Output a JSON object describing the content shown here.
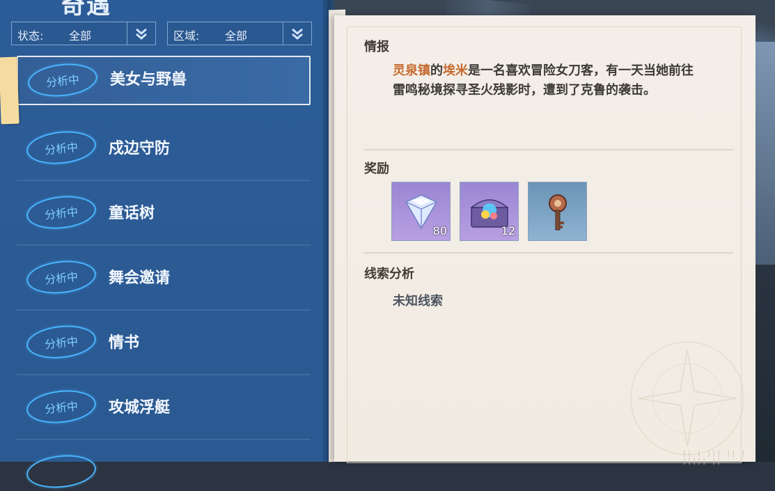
{
  "header": {
    "title": "奇遇"
  },
  "filters": {
    "status": {
      "label": "状态:",
      "value": "全部"
    },
    "region": {
      "label": "区域:",
      "value": "全部"
    }
  },
  "quests": [
    {
      "status": "分析中",
      "name": "美女与野兽",
      "selected": true
    },
    {
      "status": "分析中",
      "name": "戍边守防"
    },
    {
      "status": "分析中",
      "name": "童话树"
    },
    {
      "status": "分析中",
      "name": "舞会邀请"
    },
    {
      "status": "分析中",
      "name": "情书"
    },
    {
      "status": "分析中",
      "name": "攻城浮艇"
    },
    {
      "status": "分析中",
      "name": ""
    }
  ],
  "detail": {
    "intel_title": "情报",
    "intel": {
      "place": "灵泉镇",
      "of": "的",
      "person": "埃米",
      "rest_line1": "是一名喜欢冒险女刀客，有一天当她前往",
      "line2": "雷鸣秘境探寻圣火残影时，遭到了克鲁的袭击。"
    },
    "reward_title": "奖励",
    "rewards": [
      {
        "icon": "diamond-icon",
        "count": "80"
      },
      {
        "icon": "treasure-chest-icon",
        "count": "12"
      },
      {
        "icon": "key-item-icon",
        "count": ""
      }
    ],
    "clue_title": "线索分析",
    "clue_text": "未知线索"
  },
  "colors": {
    "panel_blue": "#2c5c97",
    "status_blue": "#49b6ff",
    "highlight_orange": "#c66a2e",
    "paper": "#f3efe8"
  }
}
